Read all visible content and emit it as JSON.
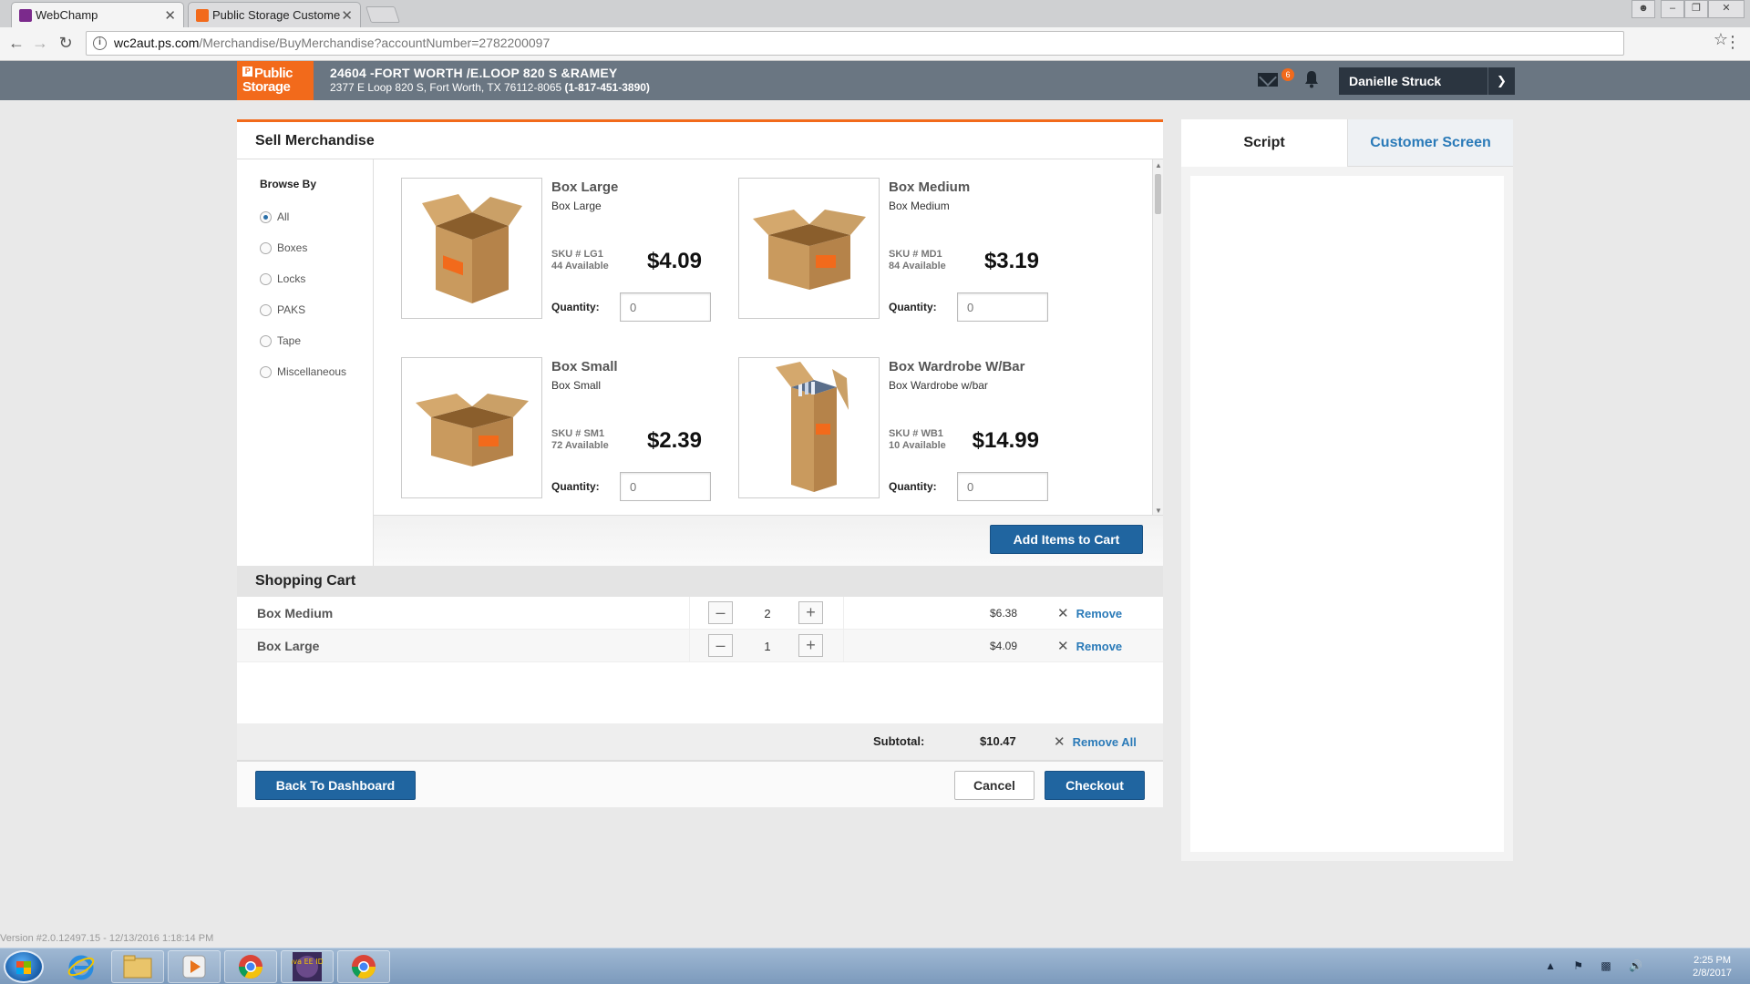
{
  "browser": {
    "tabs": [
      {
        "title": "WebChamp",
        "active": true
      },
      {
        "title": "Public Storage Customer",
        "active": false
      }
    ],
    "url_host": "wc2aut.ps.com",
    "url_path": "/Merchandise/BuyMerchandise?accountNumber=2782200097"
  },
  "header": {
    "logo_line1": "Public",
    "logo_line2": "Storage",
    "facility_name": "24604 -FORT WORTH /E.LOOP 820 S &RAMEY",
    "facility_address": "2377 E Loop 820 S, Fort Worth, TX 76112-8065",
    "facility_phone": "(1-817-451-3890)",
    "mail_count": "6",
    "user_name": "Danielle Struck"
  },
  "main": {
    "title": "Sell Merchandise",
    "browse_by_label": "Browse By",
    "browse_options": [
      {
        "label": "All",
        "selected": true
      },
      {
        "label": "Boxes",
        "selected": false
      },
      {
        "label": "Locks",
        "selected": false
      },
      {
        "label": "PAKS",
        "selected": false
      },
      {
        "label": "Tape",
        "selected": false
      },
      {
        "label": "Miscellaneous",
        "selected": false
      }
    ],
    "quantity_label": "Quantity:",
    "quantity_placeholder": "0",
    "products": [
      {
        "name": "Box Large",
        "desc": "Box Large",
        "sku": "SKU # LG1",
        "available": "44 Available",
        "price": "$4.09"
      },
      {
        "name": "Box Medium",
        "desc": "Box Medium",
        "sku": "SKU # MD1",
        "available": "84 Available",
        "price": "$3.19"
      },
      {
        "name": "Box Small",
        "desc": "Box Small",
        "sku": "SKU # SM1",
        "available": "72 Available",
        "price": "$2.39"
      },
      {
        "name": "Box Wardrobe W/Bar",
        "desc": "Box Wardrobe w/bar",
        "sku": "SKU # WB1",
        "available": "10 Available",
        "price": "$14.99"
      }
    ],
    "add_to_cart_label": "Add Items to Cart"
  },
  "cart": {
    "title": "Shopping Cart",
    "items": [
      {
        "name": "Box Medium",
        "qty": "2",
        "total": "$6.38",
        "remove_label": "Remove"
      },
      {
        "name": "Box Large",
        "qty": "1",
        "total": "$4.09",
        "remove_label": "Remove"
      }
    ],
    "subtotal_label": "Subtotal:",
    "subtotal_value": "$10.47",
    "remove_all_label": "Remove All"
  },
  "footer": {
    "back_label": "Back To Dashboard",
    "cancel_label": "Cancel",
    "checkout_label": "Checkout"
  },
  "right_panel": {
    "tab_script": "Script",
    "tab_customer": "Customer Screen"
  },
  "version_text": "Version #2.0.12497.15 - 12/13/2016 1:18:14 PM",
  "taskbar": {
    "time": "2:25 PM",
    "date": "2/8/2017",
    "java_label": "Java EE IDE"
  },
  "colors": {
    "brand_orange": "#f26a1b",
    "header_gray": "#6a7682",
    "primary_blue": "#2065a0",
    "link_blue": "#2a7ab8"
  }
}
